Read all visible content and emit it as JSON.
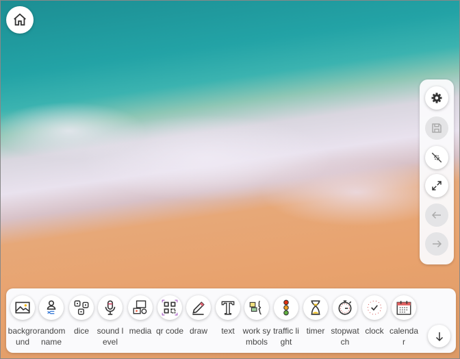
{
  "home": {
    "icon": "home-icon"
  },
  "side_panel": [
    {
      "name": "settings",
      "icon": "gear-icon",
      "enabled": true
    },
    {
      "name": "save",
      "icon": "save-icon",
      "enabled": false
    },
    {
      "name": "hide-widgets",
      "icon": "eye-off-icon",
      "enabled": true
    },
    {
      "name": "fullscreen",
      "icon": "expand-icon",
      "enabled": true
    },
    {
      "name": "undo",
      "icon": "arrow-left-icon",
      "enabled": false
    },
    {
      "name": "redo",
      "icon": "arrow-right-icon",
      "enabled": false
    }
  ],
  "toolbar": {
    "items": [
      {
        "label": "background",
        "icon": "image-icon"
      },
      {
        "label": "random name",
        "icon": "person-shuffle-icon"
      },
      {
        "label": "dice",
        "icon": "dice-icon"
      },
      {
        "label": "sound level",
        "icon": "microphone-icon"
      },
      {
        "label": "media",
        "icon": "media-icon"
      },
      {
        "label": "qr code",
        "icon": "qr-code-icon"
      },
      {
        "label": "draw",
        "icon": "pencil-icon"
      },
      {
        "label": "text",
        "icon": "text-icon"
      },
      {
        "label": "work symbols",
        "icon": "work-symbols-icon"
      },
      {
        "label": "traffic light",
        "icon": "traffic-light-icon"
      },
      {
        "label": "timer",
        "icon": "hourglass-icon"
      },
      {
        "label": "stopwatch",
        "icon": "stopwatch-icon"
      },
      {
        "label": "clock",
        "icon": "clock-icon"
      },
      {
        "label": "calendar",
        "icon": "calendar-icon"
      }
    ],
    "collapse_icon": "arrow-down-icon"
  }
}
